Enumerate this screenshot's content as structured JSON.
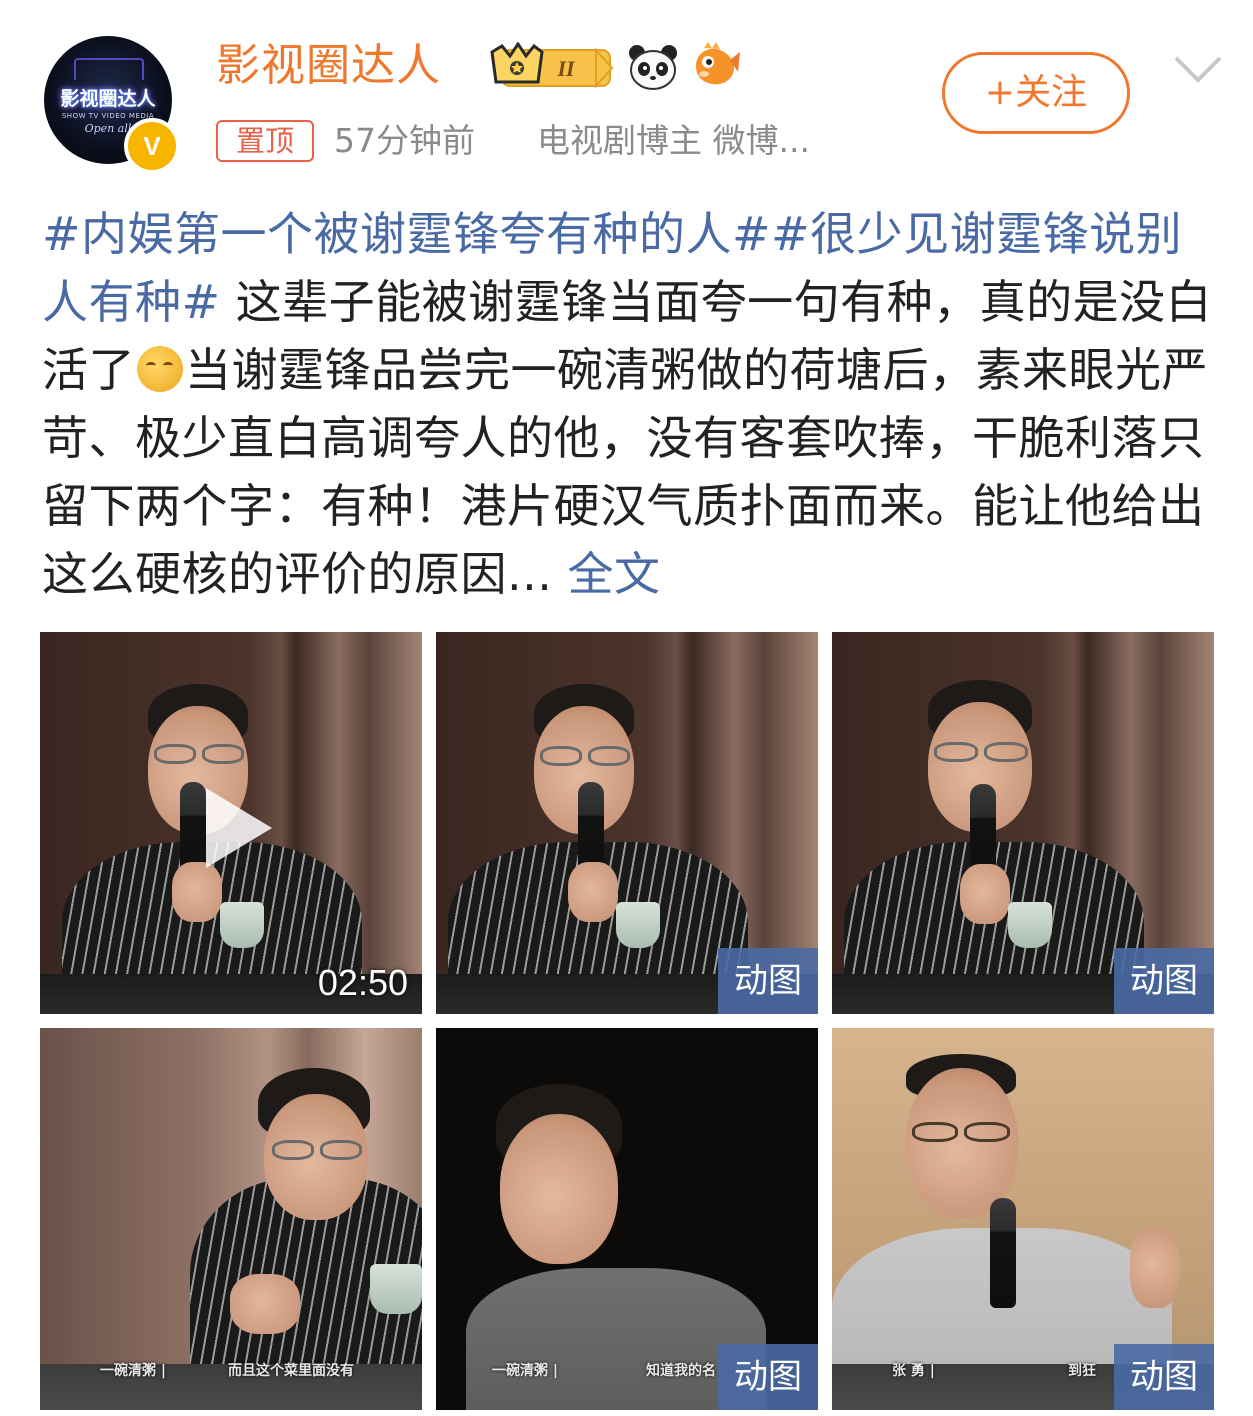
{
  "header": {
    "avatar_text": "影视圈达人",
    "avatar_sub": "SHOW TV VIDEO MEDIA",
    "avatar_script": "Open all",
    "username": "影视圈达人",
    "badge_level": "II",
    "verified_mark": "V",
    "follow_label": "+关注",
    "pin_label": "置顶",
    "time_ago": "57分钟前",
    "source": "电视剧博主 微博...",
    "accent_color": "#f0772c",
    "link_color": "#4a6aa5"
  },
  "post": {
    "hashtag1": "#内娱第一个被谢霆锋夸有种的人#",
    "hashtag2": "#很少见谢霆锋说别人有种#",
    "text_part1": " 这辈子能被谢霆锋当面夸一句有种，真的是没白活了",
    "emoji": "thinking-face",
    "text_part2": "当谢霆锋品尝完一碗清粥做的荷塘后，素来眼光严苛、极少直白高调夸人的他，没有客套吹捧，干脆利落只留下两个字：有种！港片硬汉气质扑面而来。能让他给出这么硬核的评价的原因...",
    "fulltext_label": " 全文"
  },
  "media": {
    "video_duration": "02:50",
    "gif_label": "动图",
    "subtitles": {
      "c4_left": "一碗清粥 |",
      "c4_right": "而且这个菜里面没有",
      "c5_left": "一碗清粥 |",
      "c5_right": "知道我的名",
      "c6_left": "张 勇 |",
      "c6_right": "到狂"
    }
  }
}
